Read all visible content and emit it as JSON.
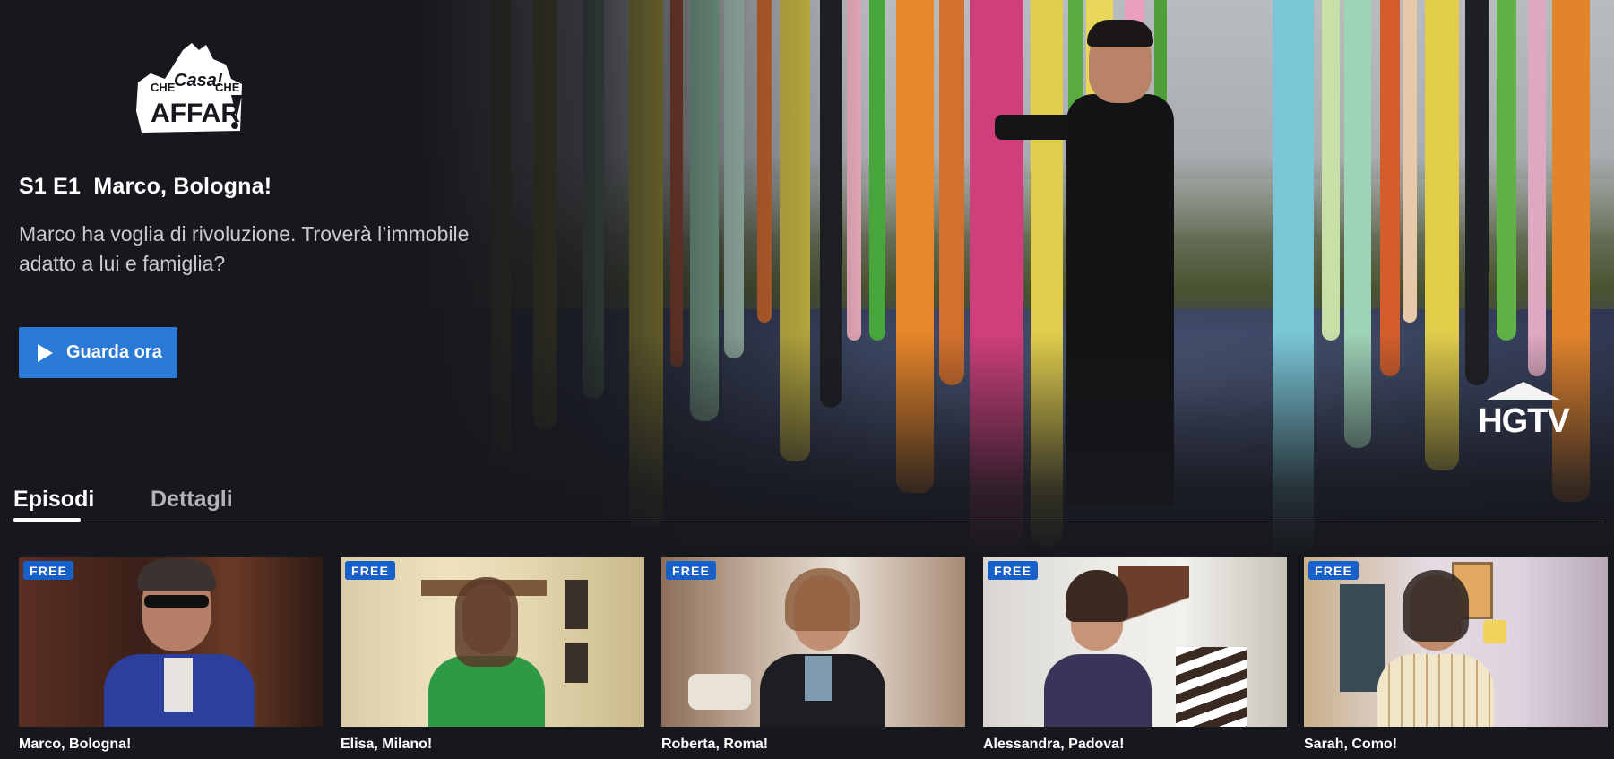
{
  "show": {
    "logo_text": "CHE CASA! CHE AFFARE!",
    "network_logo_text": "HGTV"
  },
  "hero": {
    "episode_code": "S1 E1",
    "episode_title": "Marco, Bologna!",
    "description": "Marco ha voglia di rivoluzione. Troverà l’immobile adatto a lui e famiglia?",
    "watch_label": "Guarda ora"
  },
  "tabs": [
    {
      "label": "Episodi",
      "active": true
    },
    {
      "label": "Dettagli",
      "active": false
    }
  ],
  "episodes": [
    {
      "badge": "FREE",
      "title": "Marco, Bologna!"
    },
    {
      "badge": "FREE",
      "title": "Elisa, Milano!"
    },
    {
      "badge": "FREE",
      "title": "Roberta, Roma!"
    },
    {
      "badge": "FREE",
      "title": "Alessandra, Padova!"
    },
    {
      "badge": "FREE",
      "title": "Sarah, Como!"
    }
  ],
  "colors": {
    "background": "#17181d",
    "accent_button": "#2a79d6",
    "badge": "#1760c7"
  }
}
